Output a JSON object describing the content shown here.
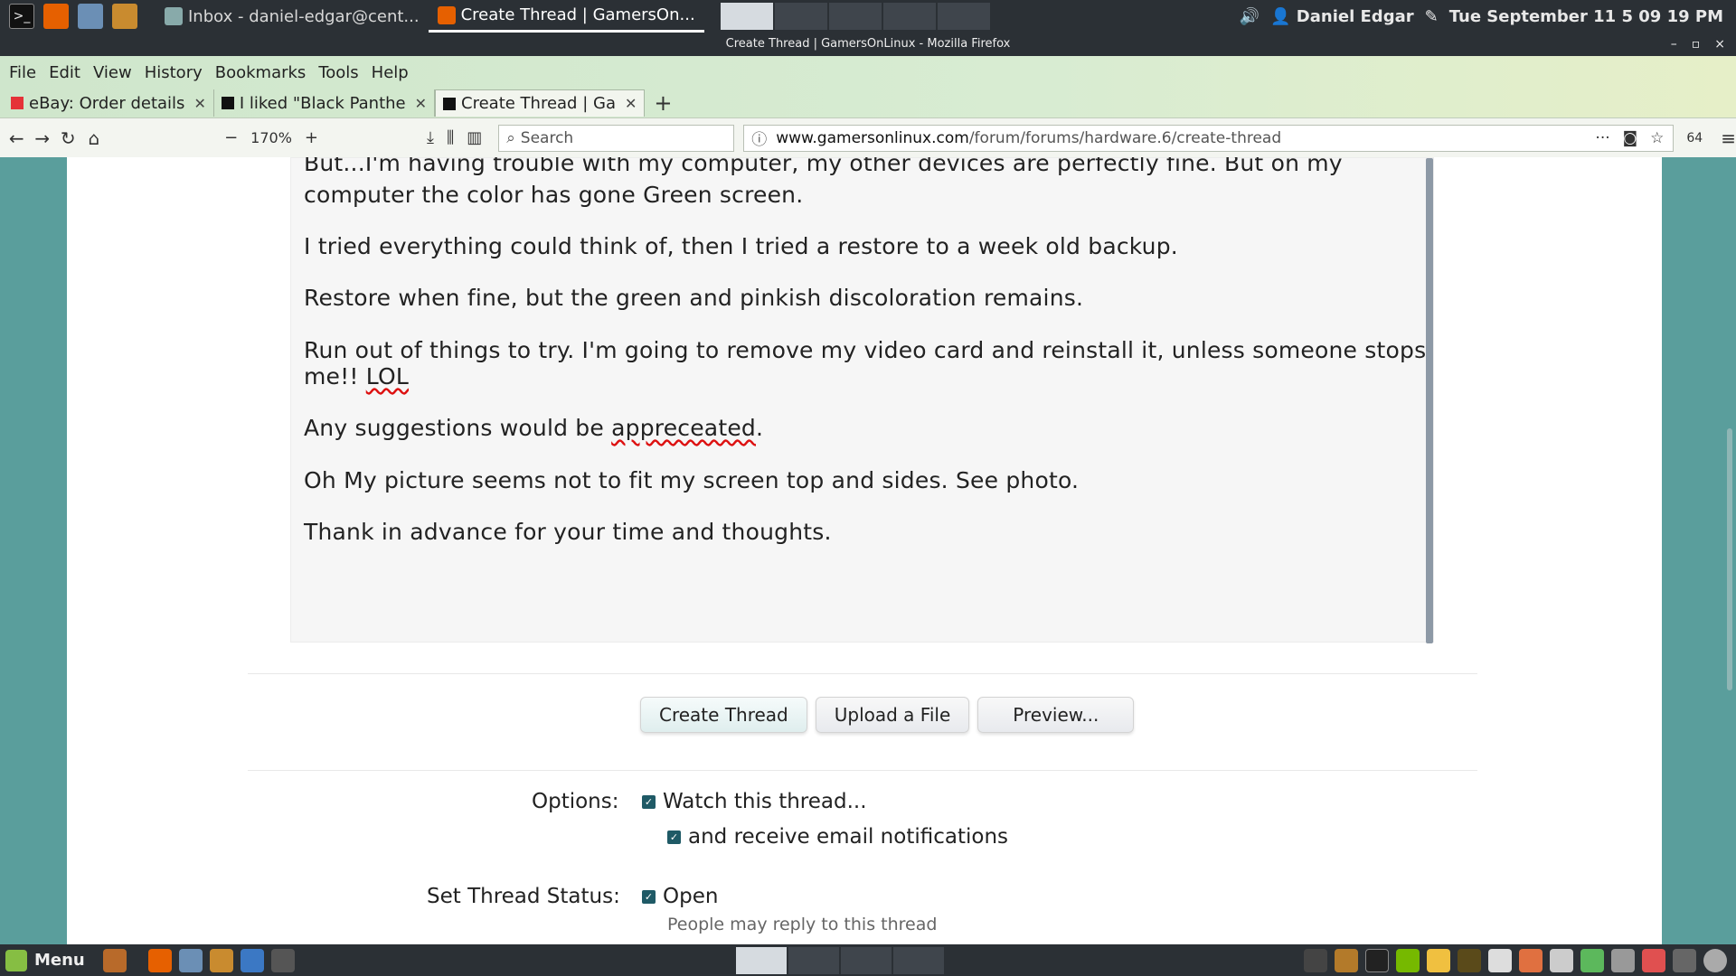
{
  "system_panel": {
    "tasks": [
      {
        "label": "Inbox - daniel-edgar@cent...",
        "active": false
      },
      {
        "label": "Create Thread | GamersOn...",
        "active": true
      }
    ],
    "user": "Daniel Edgar",
    "clock": "Tue September 11  5 09 19 PM"
  },
  "window": {
    "title": "Create Thread | GamersOnLinux - Mozilla Firefox",
    "controls": [
      "–",
      "▫",
      "×"
    ]
  },
  "browser": {
    "menu": [
      "File",
      "Edit",
      "View",
      "History",
      "Bookmarks",
      "Tools",
      "Help"
    ],
    "tabs": [
      {
        "label": "eBay: Order details",
        "active": false
      },
      {
        "label": "I liked \"Black Panthe",
        "active": false
      },
      {
        "label": "Create Thread | Ga",
        "active": true
      }
    ],
    "zoom": "170%",
    "search_placeholder": "Search",
    "url_domain": "www.gamersonlinux.com",
    "url_path": "/forum/forums/hardware.6/create-thread",
    "badge": "64"
  },
  "post": {
    "line1": "But...I'm having trouble with my computer, my other devices are perfectly fine. But on my",
    "line2": "computer the color has gone Green screen.",
    "line3": "I tried everything  could think of, then I tried a restore to a week old backup.",
    "line4": "Restore when fine, but the green and pinkish discoloration remains.",
    "line5": "Run out of things to try. I'm going to remove my video card and reinstall it, unless someone stops",
    "line6a": "me!! ",
    "line6b": "LOL",
    "line7a": "Any suggestions would be ",
    "line7b": "appreceated",
    "line7c": ".",
    "line8": "Oh My picture seems not to fit my screen top and sides. See photo.",
    "line9": "Thank in advance for your time and thoughts."
  },
  "actions": {
    "create": "Create Thread",
    "upload": "Upload a File",
    "preview": "Preview..."
  },
  "options": {
    "label": "Options:",
    "watch": "Watch this thread...",
    "email": "and receive email notifications",
    "status_label": "Set Thread Status:",
    "open": "Open",
    "open_hint": "People may reply to this thread"
  },
  "taskbar": {
    "menu": "Menu"
  }
}
